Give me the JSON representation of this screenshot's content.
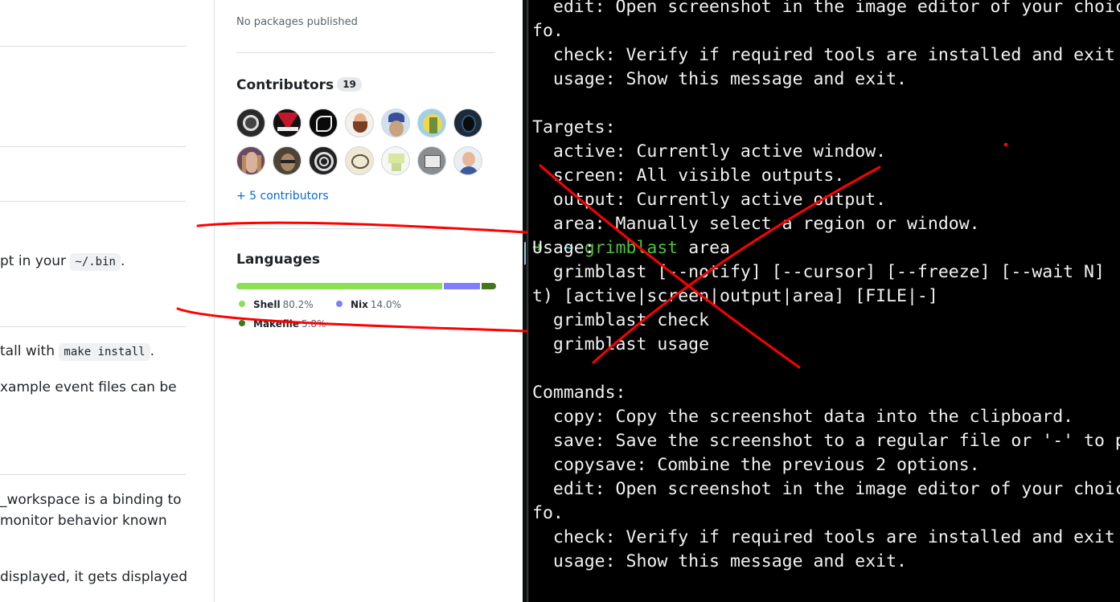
{
  "readme": {
    "line1_text": "pt in your ",
    "line1_code": "~/.bin",
    "line1_end": ".",
    "line2_text": "tall with ",
    "line2_code": "make install",
    "line2_end": ".",
    "line3": "xample event files can be",
    "line4": "_workspace is a binding to",
    "line5": "monitor behavior known",
    "line6": "displayed, it gets displayed"
  },
  "sidebar": {
    "packages_empty": "No packages published",
    "contributors_title": "Contributors",
    "contributors_count": "19",
    "more_contributors": "+ 5 contributors",
    "languages_title": "Languages",
    "languages": [
      {
        "name": "Shell",
        "percent": "80.2%",
        "value": 80.2,
        "color": "#89e051"
      },
      {
        "name": "Nix",
        "percent": "14.0%",
        "value": 14.0,
        "color": "#7e7eff"
      },
      {
        "name": "Makefile",
        "percent": "5.8%",
        "value": 5.8,
        "color": "#427819"
      }
    ]
  },
  "terminal": {
    "lines": [
      "  edit: Open screenshot in the image editor of your choic",
      "fo.",
      "  check: Verify if required tools are installed and exit",
      "  usage: Show this message and exit.",
      "",
      "Targets:",
      "  active: Currently active window.",
      "  screen: All visible outputs.",
      "  output: Currently active output.",
      "  area: Manually select a region or window.",
      "",
      "Usage:",
      "  grimblast [--notify] [--cursor] [--freeze] [--wait N]",
      "t) [active|screen|output|area] [FILE|-]",
      "  grimblast check",
      "  grimblast usage",
      "",
      "Commands:",
      "  copy: Copy the screenshot data into the clipboard.",
      "  save: Save the screenshot to a regular file or '-' to p",
      "  copysave: Combine the previous 2 options.",
      "  edit: Open screenshot in the image editor of your choic",
      "fo.",
      "  check: Verify if required tools are installed and exit",
      "  usage: Show this message and exit."
    ],
    "prompt_arrow": "➜",
    "prompt_dir": "~",
    "prompt_cmd": "grimblast",
    "prompt_args": " area"
  }
}
